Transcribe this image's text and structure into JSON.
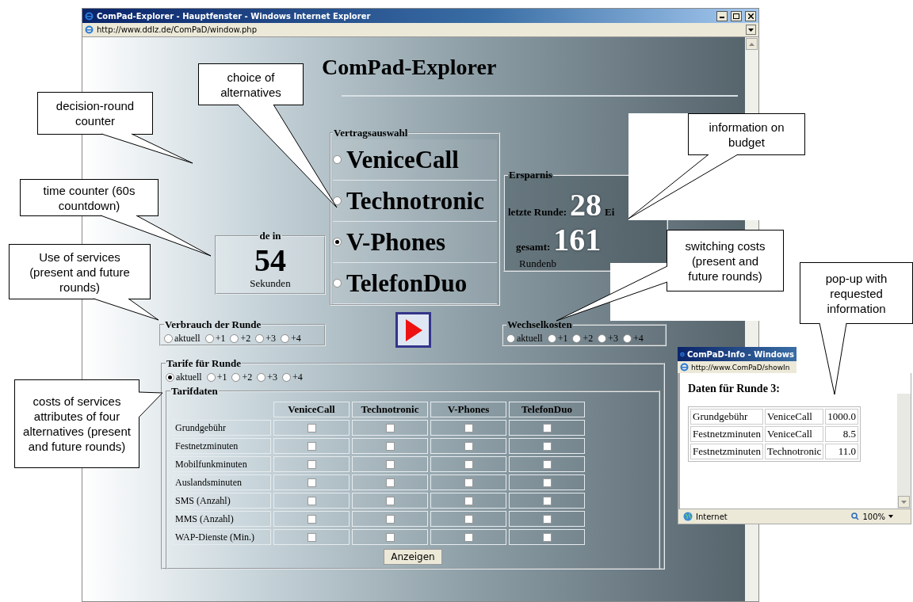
{
  "window": {
    "title": "ComPad-Explorer - Hauptfenster - Windows Internet Explorer",
    "address": "http://www.ddlz.de/ComPaD/window.php"
  },
  "page": {
    "heading": "ComPad-Explorer",
    "timer": {
      "legend": "de in",
      "value": "54",
      "unit": "Sekunden"
    },
    "contract_choice": {
      "legend": "Vertragsauswahl",
      "options": [
        {
          "label": "VeniceCall",
          "selected": false
        },
        {
          "label": "Technotronic",
          "selected": false
        },
        {
          "label": "V-Phones",
          "selected": true
        },
        {
          "label": "TelefonDuo",
          "selected": false
        }
      ]
    },
    "savings": {
      "legend": "Ersparnis",
      "last_round_label": "letzte Runde:",
      "last_round_value": "28",
      "last_round_unit": "Ei",
      "total_label": "gesamt:",
      "total_value": "161",
      "note": "Rundenb"
    },
    "usage": {
      "legend": "Verbrauch der Runde",
      "options": [
        {
          "label": "aktuell",
          "selected": false
        },
        {
          "label": "+1",
          "selected": false
        },
        {
          "label": "+2",
          "selected": false
        },
        {
          "label": "+3",
          "selected": false
        },
        {
          "label": "+4",
          "selected": false
        }
      ]
    },
    "switching_costs": {
      "legend": "Wechselkosten",
      "options": [
        {
          "label": "aktuell",
          "selected": false
        },
        {
          "label": "+1",
          "selected": false
        },
        {
          "label": "+2",
          "selected": false
        },
        {
          "label": "+3",
          "selected": false
        },
        {
          "label": "+4",
          "selected": false
        }
      ]
    },
    "tariffs": {
      "legend": "Tarife für Runde",
      "options": [
        {
          "label": "aktuell",
          "selected": true
        },
        {
          "label": "+1",
          "selected": false
        },
        {
          "label": "+2",
          "selected": false
        },
        {
          "label": "+3",
          "selected": false
        },
        {
          "label": "+4",
          "selected": false
        }
      ],
      "data": {
        "legend": "Tarifdaten",
        "columns": [
          "VeniceCall",
          "Technotronic",
          "V-Phones",
          "TelefonDuo"
        ],
        "rows": [
          {
            "label": "Grundgebühr",
            "checked": [
              false,
              false,
              false,
              false
            ]
          },
          {
            "label": "Festnetzminuten",
            "checked": [
              false,
              false,
              false,
              false
            ]
          },
          {
            "label": "Mobilfunkminuten",
            "checked": [
              false,
              false,
              false,
              false
            ]
          },
          {
            "label": "Auslandsminuten",
            "checked": [
              false,
              false,
              false,
              false
            ]
          },
          {
            "label": "SMS (Anzahl)",
            "checked": [
              false,
              false,
              false,
              false
            ]
          },
          {
            "label": "MMS (Anzahl)",
            "checked": [
              false,
              false,
              false,
              false
            ]
          },
          {
            "label": "WAP-Dienste (Min.)",
            "checked": [
              false,
              false,
              false,
              false
            ]
          }
        ]
      },
      "button": "Anzeigen"
    }
  },
  "popup": {
    "title": "ComPaD-Info - Windows",
    "address": "http://www.ComPaD/showIn",
    "heading": "Daten für Runde 3:",
    "rows": [
      [
        "Grundgebühr",
        "VeniceCall",
        "1000.0"
      ],
      [
        "Festnetzminuten",
        "VeniceCall",
        "8.5"
      ],
      [
        "Festnetzminuten",
        "Technotronic",
        "11.0"
      ]
    ],
    "status": "Internet",
    "zoom": "100%"
  },
  "callouts": [
    {
      "text": "decision-round counter"
    },
    {
      "text": "choice of alternatives"
    },
    {
      "text": "time counter (60s countdown)"
    },
    {
      "text": "Use of services (present and future rounds)"
    },
    {
      "text": "costs of services attributes of four alternatives (present and future rounds)"
    },
    {
      "text": "information on budget"
    },
    {
      "text": "switching costs (present and future rounds)"
    },
    {
      "text": "pop-up with requested information"
    }
  ]
}
